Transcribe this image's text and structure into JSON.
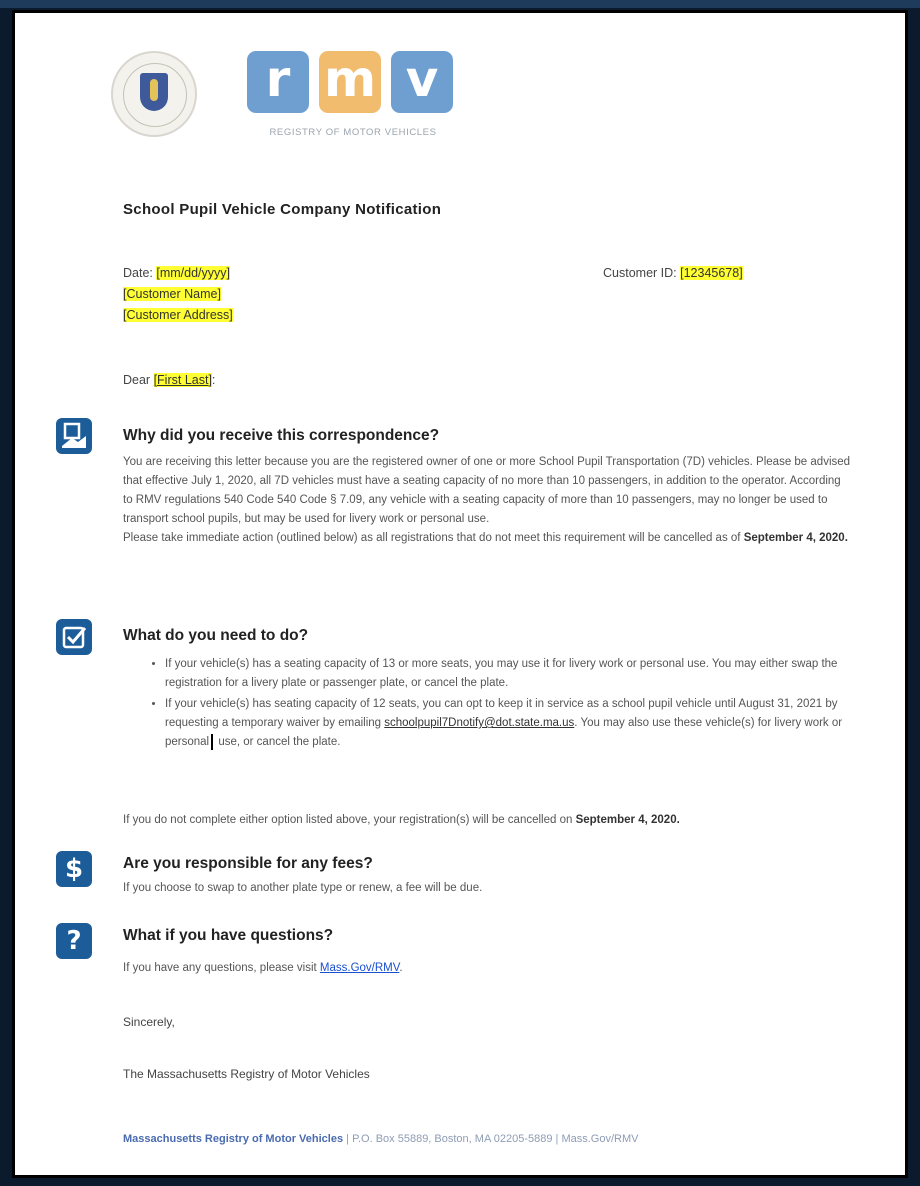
{
  "header": {
    "seal_alt": "Commonwealth of Massachusetts seal",
    "logo": {
      "letters": [
        "r",
        "m",
        "v"
      ],
      "subtitle": "REGISTRY OF MOTOR VEHICLES"
    },
    "colors": {
      "logo_blue": "#6f9fd0",
      "logo_orange": "#f2bc6e",
      "icon_blue": "#1c5c99",
      "highlight": "#ffff33"
    }
  },
  "document": {
    "title": "School Pupil Vehicle Company Notification",
    "date_label": "Date:",
    "date_value": "[mm/dd/yyyy]",
    "customer_name": "[Customer Name]",
    "customer_address": "[Customer Address]",
    "customer_id_label": "Customer ID:",
    "customer_id_value": "[12345678]",
    "salutation_prefix": "Dear",
    "salutation_name": "[First Last]",
    "salutation_suffix": ":"
  },
  "sections": {
    "why": {
      "icon": "document-hand-icon",
      "heading": "Why did you receive this correspondence?",
      "body1": "You are receiving this letter because you are the registered owner of one or more School Pupil Transportation (7D) vehicles. Please be advised that effective July 1, 2020, all 7D vehicles must have a seating capacity of no more than 10 passengers, in addition to the operator. According to RMV regulations 540 Code 540 Code § 7.09, any vehicle with a seating capacity of more than 10 passengers, may no longer be used to transport school pupils, but may be used for livery work or personal use.",
      "body2_prefix": "Please take immediate action (outlined below) as all registrations that do not meet this requirement will be cancelled as of",
      "body2_date": "September 4, 2020."
    },
    "what": {
      "icon": "checkbox-icon",
      "heading": "What do you need to do?",
      "bullet1": "If your vehicle(s) has a seating capacity of 13 or more seats, you may use it for livery work or personal use. You may either swap the registration for a livery plate or passenger plate, or cancel the plate.",
      "bullet2_prefix": "If your vehicle(s) has seating capacity of 12 seats, you can opt to keep it in service as a school pupil vehicle until August 31, 2021 by requesting a temporary waiver by emailing",
      "bullet2_email": "schoolpupil7Dnotify@dot.state.ma.us",
      "bullet2_suffix_a": ". You may also use these vehicle(s) for livery work or personal",
      "bullet2_suffix_b": "use, or cancel the plate.",
      "note_prefix": "If you do not complete either option listed above, your registration(s) will be cancelled on",
      "note_date": "September 4, 2020."
    },
    "fees": {
      "icon": "dollar-icon",
      "heading": "Are you responsible for any fees?",
      "body": "If you choose to swap to another plate type or renew, a fee will be due."
    },
    "questions": {
      "icon": "question-icon",
      "heading": "What if you have questions?",
      "body_prefix": "If you have any questions, please visit",
      "link": "Mass.Gov/RMV",
      "body_suffix": "."
    }
  },
  "closing": {
    "sign_off": "Sincerely,",
    "signature": "The Massachusetts Registry of Motor Vehicles"
  },
  "footer": {
    "org": "Massachusetts Registry of Motor Vehicles",
    "sep": "|",
    "address": "P.O. Box 55889, Boston, MA 02205-5889",
    "site": "Mass.Gov/RMV"
  }
}
